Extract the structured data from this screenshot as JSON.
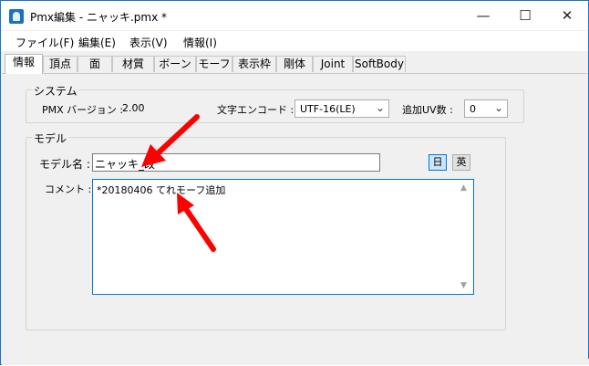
{
  "window": {
    "title": "Pmx編集 - ニャッキ.pmx *",
    "minimize": "—",
    "maximize": "☐",
    "close": "✕"
  },
  "menu": [
    "ファイル(F)",
    "編集(E)",
    "表示(V)",
    "情報(I)"
  ],
  "tabs": [
    "情報",
    "頂点",
    "面",
    "材質",
    "ボーン",
    "モーフ",
    "表示枠",
    "剛体",
    "Joint",
    "SoftBody"
  ],
  "system": {
    "group_title": "システム",
    "version_label": "PMX バージョン :",
    "version_value": "2.00",
    "encode_label": "文字エンコード :",
    "encode_value": "UTF-16(LE)",
    "uv_label": "追加UV数 :",
    "uv_value": "0"
  },
  "model": {
    "group_title": "モデル",
    "name_label": "モデル名 :",
    "name_value": "ニャッキ_改",
    "lang_jp": "日",
    "lang_en": "英",
    "comment_label": "コメント :",
    "comment_value": "*20180406 てれモーフ追加"
  },
  "colors": {
    "annotation_arrow": "#ff0000",
    "accent": "#0078d7"
  },
  "icons": {
    "combo_arrow": "chevron-down-icon"
  }
}
